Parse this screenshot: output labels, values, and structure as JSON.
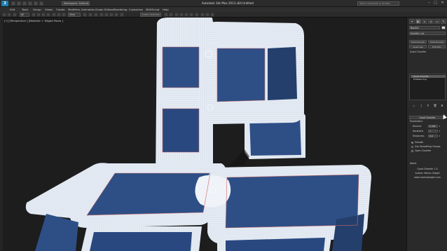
{
  "window": {
    "title": "Autodesk 3ds Max  2013 x64    Untitled",
    "workspace": "Workspace: Default",
    "search_placeholder": "Type a keyword or phrase",
    "minimize": "‒",
    "maximize": "□",
    "close": "✕"
  },
  "menubar": [
    "Edit",
    "Tools",
    "Group",
    "Views",
    "Create",
    "Modifiers",
    "Animation",
    "Graph Editors",
    "Rendering",
    "Customize",
    "MAXScript",
    "Help"
  ],
  "toolbar": {
    "filter_select": "All",
    "ref_coord_select": "View",
    "named_selection_placeholder": "Create Selection Se"
  },
  "viewport": {
    "label": "[+] [Perspective ] [Realistic + Edged Faces ]",
    "colors": {
      "background": "#1d1d1d",
      "face_blue": "#2e4f86",
      "face_blue_dark": "#243f6c",
      "chamfer_white": "#dfe6f0",
      "wire": "#ffffff",
      "edge_red": "#c86a6a"
    }
  },
  "command_panel": {
    "tabs": [
      "create-icon",
      "modify-icon",
      "hierarchy-icon",
      "motion-icon",
      "display-icon",
      "utilities-icon"
    ],
    "object_name": "Box001",
    "modifier_list": "Modifier List",
    "buttons": [
      "TurboSmooth",
      "TurboSmooth",
      "Quad Cap",
      "Edit Poly"
    ],
    "section_label": "Quad Chamfer",
    "stack": [
      "Quad Chamfer",
      "Editable Poly"
    ],
    "rollout_title": "Quad Chamfer",
    "parameters_label": "Parameters",
    "params": [
      {
        "label": "Amount",
        "value": "6,496"
      },
      {
        "label": "Iterations",
        "value": "7"
      },
      {
        "label": "Sharpness",
        "value": "0,0"
      }
    ],
    "options": {
      "smooth": "Smooth",
      "use_smoothing_groups": "Use Smoothing Groups",
      "open_chamfer": "Open Chamfer"
    },
    "about_label": "About",
    "about_lines": [
      "Quad Chamfer 1.0",
      "Author: Marius Silaghi",
      "www.mariussilaghi.com"
    ]
  }
}
